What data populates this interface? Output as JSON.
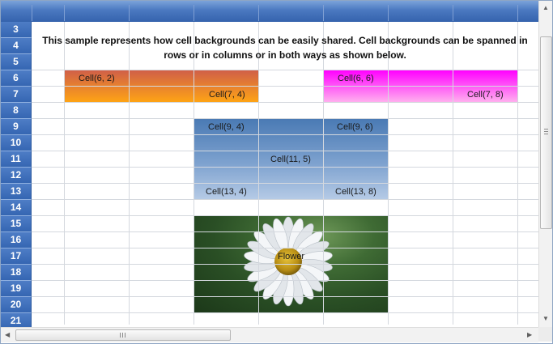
{
  "description": {
    "line1": "This sample represents how cell backgrounds can be easily shared. Cell backgrounds can be spanned in",
    "line2": "rows or in columns or in both ways as shown below."
  },
  "row_headers": [
    "3",
    "4",
    "5",
    "6",
    "7",
    "8",
    "9",
    "10",
    "11",
    "12",
    "13",
    "14",
    "15",
    "16",
    "17",
    "18",
    "19",
    "20",
    "21"
  ],
  "blocks": {
    "orange": {
      "top_left": "Cell(6, 2)",
      "bottom_right": "Cell(7, 4)"
    },
    "magenta": {
      "top_left": "Cell(6, 6)",
      "bottom_right": "Cell(7, 8)"
    },
    "blue": {
      "top_left": "Cell(9, 4)",
      "top_right": "Cell(9, 6)",
      "center": "Cell(11, 5)",
      "bottom_left": "Cell(13, 4)",
      "bottom_right": "Cell(13, 8)"
    },
    "image": {
      "label": "Flower"
    }
  },
  "colors": {
    "header_blue": "#3d6db6",
    "orange_top": "#d05f48",
    "orange_bottom": "#ffa514",
    "magenta_top": "#ff00ff",
    "magenta_bottom": "#ffb4ee",
    "blue_top": "#4a7ab4",
    "blue_bottom": "#b6cbe6"
  }
}
